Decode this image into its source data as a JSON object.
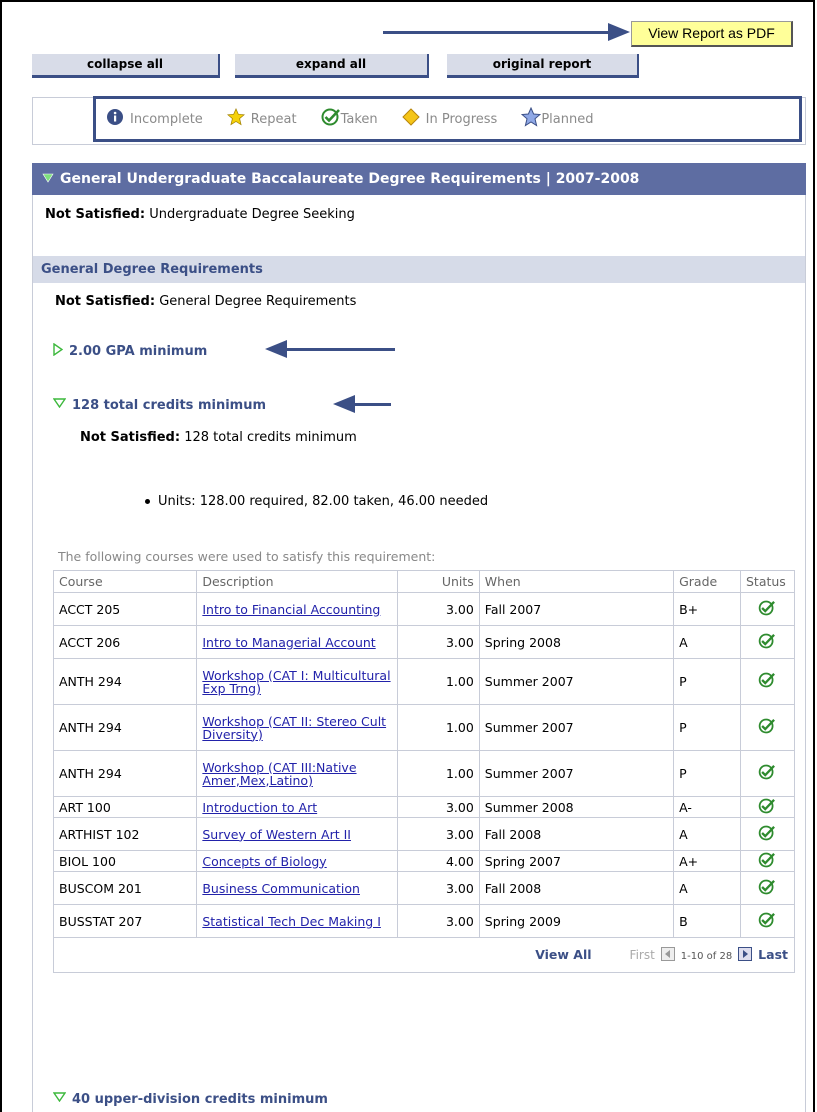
{
  "toolbar": {
    "pdf_label": "View Report as PDF",
    "collapse_label": "collapse all",
    "expand_label": "expand all",
    "original_label": "original report"
  },
  "legend": {
    "incomplete": "Incomplete",
    "repeat": "Repeat",
    "taken": "Taken",
    "in_progress": "In Progress",
    "planned": "Planned"
  },
  "section": {
    "title": "General Undergraduate Baccalaureate Degree Requirements | 2007-2008",
    "status_label": "Not Satisfied:",
    "status_text": "Undergraduate Degree Seeking"
  },
  "group": {
    "title": "General Degree Requirements",
    "status_label": "Not Satisfied:",
    "status_text": "General Degree Requirements"
  },
  "requirements": {
    "gpa": "2.00 GPA minimum",
    "credits": "128 total credits minimum",
    "credits_status_label": "Not Satisfied:",
    "credits_status_text": "128 total credits minimum",
    "units_line": "Units: 128.00 required, 82.00 taken, 46.00 needed",
    "courses_intro": "The following courses were used to satisfy this requirement:",
    "upper_division": "40 upper-division credits minimum"
  },
  "table": {
    "headers": [
      "Course",
      "Description",
      "Units",
      "When",
      "Grade",
      "Status"
    ],
    "rows": [
      {
        "course": "ACCT 205",
        "desc": "Intro to Financial Accounting",
        "units": "3.00",
        "when": "Fall 2007",
        "grade": "B+"
      },
      {
        "course": "ACCT 206",
        "desc": "Intro to Managerial Account",
        "units": "3.00",
        "when": "Spring 2008",
        "grade": "A"
      },
      {
        "course": "ANTH 294",
        "desc": "Workshop (CAT I: Multicultural Exp Trng)",
        "units": "1.00",
        "when": "Summer 2007",
        "grade": "P"
      },
      {
        "course": "ANTH 294",
        "desc": "Workshop (CAT II: Stereo Cult Diversity)",
        "units": "1.00",
        "when": "Summer 2007",
        "grade": "P"
      },
      {
        "course": "ANTH 294",
        "desc": "Workshop (CAT III:Native Amer,Mex,Latino)",
        "units": "1.00",
        "when": "Summer 2007",
        "grade": "P"
      },
      {
        "course": "ART 100",
        "desc": "Introduction to Art",
        "units": "3.00",
        "when": "Summer 2008",
        "grade": "A-"
      },
      {
        "course": "ARTHIST 102",
        "desc": "Survey of Western Art II",
        "units": "3.00",
        "when": "Fall 2008",
        "grade": "A"
      },
      {
        "course": "BIOL 100",
        "desc": "Concepts of Biology",
        "units": "4.00",
        "when": "Spring 2007",
        "grade": "A+"
      },
      {
        "course": "BUSCOM 201",
        "desc": "Business Communication",
        "units": "3.00",
        "when": "Fall 2008",
        "grade": "A"
      },
      {
        "course": "BUSSTAT 207",
        "desc": "Statistical Tech Dec Making I",
        "units": "3.00",
        "when": "Spring 2009",
        "grade": "B"
      }
    ],
    "view_all": "View All",
    "first": "First",
    "range": "1-10 of 28",
    "last": "Last"
  },
  "colors": {
    "accent": "#3b4f86",
    "header_bg": "#5e6da2",
    "check": "#2e8b2e"
  }
}
